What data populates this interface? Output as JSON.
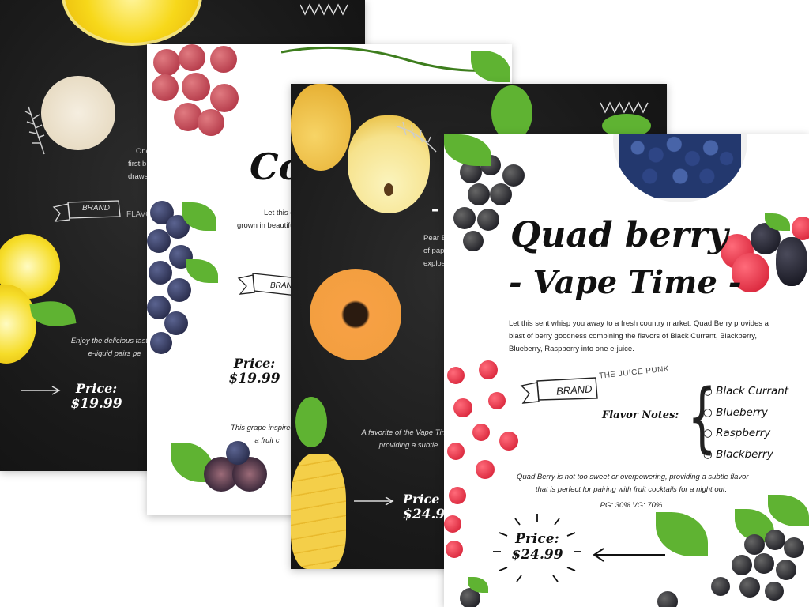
{
  "card1": {
    "price_label": "Price:",
    "price_value": "$19.99",
    "brand_label": "BRAND",
    "flavor_label": "FLAVOR",
    "text_lines": [
      "One",
      "first b",
      "draws"
    ],
    "desc_lines": [
      "Enjoy the delicious taste o",
      "e-liquid pairs pe"
    ]
  },
  "card2": {
    "title": "Co",
    "text_lines": [
      "Let this e",
      "grown in beautifu"
    ],
    "brand_label": "BRAN",
    "price_label": "Price:",
    "price_value": "$19.99",
    "desc_lines": [
      "This grape inspired e-",
      "a fruit c"
    ]
  },
  "card3": {
    "title_fragment": "-",
    "text_lines": [
      "Pear B",
      "of pap",
      "explos"
    ],
    "fav_lines": [
      "A favorite of the Vape Tim",
      "providing a subtle"
    ],
    "price_label": "Price",
    "price_value": "$24.9"
  },
  "card4": {
    "title_line1": "Quad berry",
    "title_line2": "- Vape Time -",
    "intro_lines": [
      "Let this sent whisp you away to a fresh country market. Quad Berry provides a",
      "blast of berry goodness combining the flavors of Black Currant, Blackberry,",
      "Blueberry, Raspberry into one e-juice."
    ],
    "brand_label": "BRAND",
    "brand_name": "THE JUICE PUNK",
    "flavor_notes_label": "Flavor Notes:",
    "flavor_notes": [
      "Black Currant",
      "Blueberry",
      "Raspberry",
      "Blackberry"
    ],
    "desc_lines": [
      "Quad Berry is not too sweet or overpowering, providing a subtle flavor",
      "that is perfect for pairing with fruit cocktails for a night out."
    ],
    "pg_vg": "PG: 30% VG: 70%",
    "price_label": "Price:",
    "price_value": "$24.99"
  }
}
